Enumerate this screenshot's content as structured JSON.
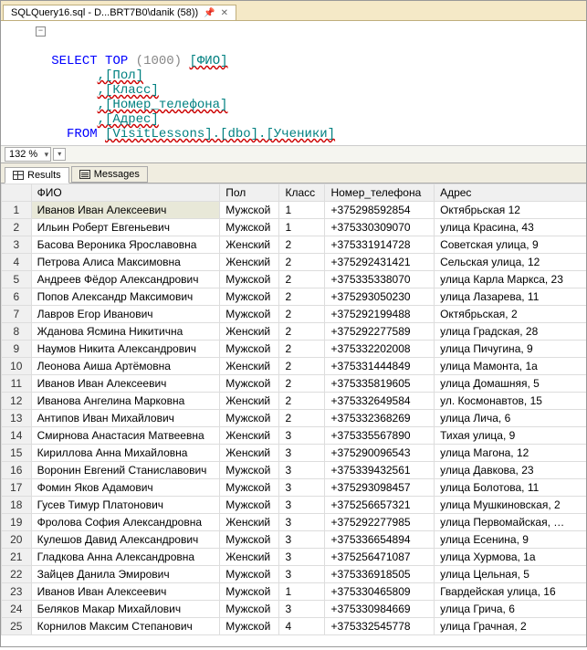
{
  "tab": {
    "title": "SQLQuery16.sql - D...BRT7B0\\danik (58))"
  },
  "zoom": {
    "value": "132 %"
  },
  "sql": {
    "select": "SELECT",
    "top": "TOP",
    "topn": "(1000)",
    "col1": "[ФИО]",
    "col2": ",[Пол]",
    "col3": ",[Класс]",
    "col4": ",[Номер_телефона]",
    "col5": ",[Адрес]",
    "from": "FROM",
    "src": "[VisitLessons].[dbo].[Ученики]"
  },
  "result_tabs": {
    "results": "Results",
    "messages": "Messages"
  },
  "columns": [
    "ФИО",
    "Пол",
    "Класс",
    "Номер_телефона",
    "Адрес"
  ],
  "rows": [
    {
      "n": 1,
      "fio": "Иванов Иван Алексеевич",
      "pol": "Мужской",
      "kls": "1",
      "tel": "+375298592854",
      "adr": "Октябрьская 12"
    },
    {
      "n": 2,
      "fio": "Ильин Роберт Евгеньевич",
      "pol": "Мужской",
      "kls": "1",
      "tel": "+375330309070",
      "adr": "улица Красина, 43"
    },
    {
      "n": 3,
      "fio": "Басова Вероника Ярославовна",
      "pol": "Женский",
      "kls": "2",
      "tel": "+375331914728",
      "adr": "Советская улица, 9"
    },
    {
      "n": 4,
      "fio": "Петрова Алиса Максимовна",
      "pol": "Женский",
      "kls": "2",
      "tel": "+375292431421",
      "adr": "Сельская улица, 12"
    },
    {
      "n": 5,
      "fio": "Андреев Фёдор Александрович",
      "pol": "Мужской",
      "kls": "2",
      "tel": "+375335338070",
      "adr": "улица Карла Маркса, 23"
    },
    {
      "n": 6,
      "fio": "Попов Александр Максимович",
      "pol": "Мужской",
      "kls": "2",
      "tel": "+375293050230",
      "adr": "улица Лазарева, 11"
    },
    {
      "n": 7,
      "fio": "Лавров Егор Иванович",
      "pol": "Мужской",
      "kls": "2",
      "tel": "+375292199488",
      "adr": "Октябрьская, 2"
    },
    {
      "n": 8,
      "fio": "Жданова Ясмина Никитична",
      "pol": "Женский",
      "kls": "2",
      "tel": "+375292277589",
      "adr": "улица Градская, 28"
    },
    {
      "n": 9,
      "fio": "Наумов Никита Александрович",
      "pol": "Мужской",
      "kls": "2",
      "tel": "+375332202008",
      "adr": "улица Пичугина, 9"
    },
    {
      "n": 10,
      "fio": "Леонова Аиша Артёмовна",
      "pol": "Женский",
      "kls": "2",
      "tel": "+375331444849",
      "adr": "улица Мамонта, 1а"
    },
    {
      "n": 11,
      "fio": "Иванов Иван Алексеевич",
      "pol": "Мужской",
      "kls": "2",
      "tel": "+375335819605",
      "adr": "улица Домашняя, 5"
    },
    {
      "n": 12,
      "fio": "Иванова Ангелина Марковна",
      "pol": "Женский",
      "kls": "2",
      "tel": "+375332649584",
      "adr": "ул. Космонавтов, 15"
    },
    {
      "n": 13,
      "fio": "Антипов Иван Михайлович",
      "pol": "Мужской",
      "kls": "2",
      "tel": "+375332368269",
      "adr": "улица Лича, 6"
    },
    {
      "n": 14,
      "fio": "Смирнова Анастасия Матвеевна",
      "pol": "Женский",
      "kls": "3",
      "tel": "+375335567890",
      "adr": "Тихая улица, 9"
    },
    {
      "n": 15,
      "fio": "Кириллова Анна Михайловна",
      "pol": "Женский",
      "kls": "3",
      "tel": "+375290096543",
      "adr": "улица Магона, 12"
    },
    {
      "n": 16,
      "fio": "Воронин Евгений Станиславович",
      "pol": "Мужской",
      "kls": "3",
      "tel": "+375339432561",
      "adr": "улица Давкова, 23"
    },
    {
      "n": 17,
      "fio": "Фомин Яков Адамович",
      "pol": "Мужской",
      "kls": "3",
      "tel": "+375293098457",
      "adr": "улица Болотова, 11"
    },
    {
      "n": 18,
      "fio": "Гусев Тимур Платонович",
      "pol": "Мужской",
      "kls": "3",
      "tel": "+375256657321",
      "adr": "улица Мушкиновская, 2"
    },
    {
      "n": 19,
      "fio": "Фролова София Александровна",
      "pol": "Женский",
      "kls": "3",
      "tel": "+375292277985",
      "adr": "улица Первомайская, …"
    },
    {
      "n": 20,
      "fio": "Кулешов Давид Александрович",
      "pol": "Мужской",
      "kls": "3",
      "tel": "+375336654894",
      "adr": "улица Есенина, 9"
    },
    {
      "n": 21,
      "fio": "Гладкова Анна Александровна",
      "pol": "Женский",
      "kls": "3",
      "tel": "+375256471087",
      "adr": "улица Хурмова, 1а"
    },
    {
      "n": 22,
      "fio": "Зайцев Данила Эмирович",
      "pol": "Мужской",
      "kls": "3",
      "tel": "+375336918505",
      "adr": "улица Цельная, 5"
    },
    {
      "n": 23,
      "fio": "Иванов Иван Алексеевич",
      "pol": "Мужской",
      "kls": "1",
      "tel": "+375330465809",
      "adr": "Гвардейская улица, 16"
    },
    {
      "n": 24,
      "fio": "Беляков Макар Михайлович",
      "pol": "Мужской",
      "kls": "3",
      "tel": "+375330984669",
      "adr": "улица Грича, 6"
    },
    {
      "n": 25,
      "fio": "Корнилов Максим Степанович",
      "pol": "Мужской",
      "kls": "4",
      "tel": "+375332545778",
      "adr": "улица Грачная, 2"
    }
  ]
}
